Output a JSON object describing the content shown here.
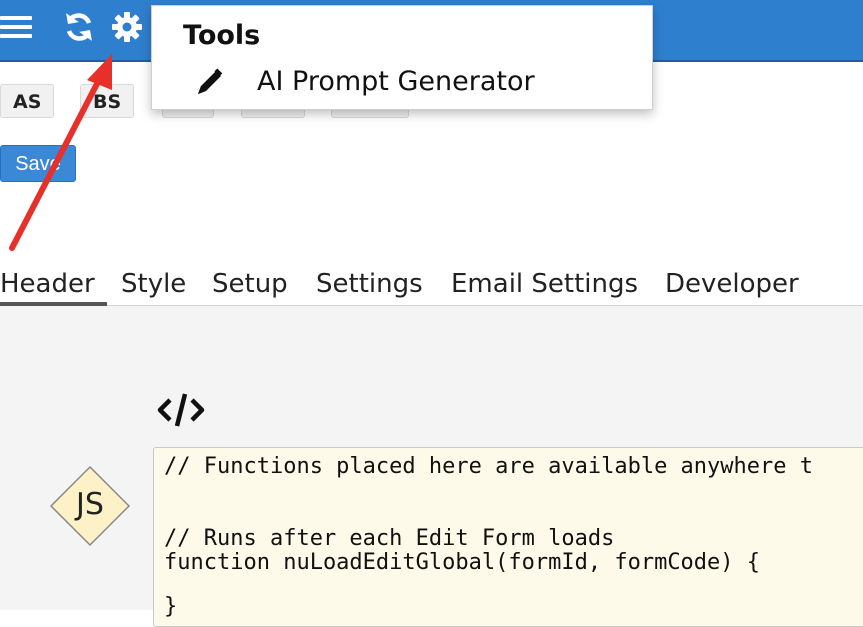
{
  "topbar": {
    "menu_icon": "hamburger-menu-icon",
    "refresh_icon": "refresh-icon",
    "settings_icon": "gear-icon",
    "bg_color": "#2f7fcf"
  },
  "toolbar": {
    "as_label": "AS",
    "bs_label": "BS",
    "save_label": "Save"
  },
  "tools_menu": {
    "title": "Tools",
    "items": [
      {
        "label": "AI Prompt Generator",
        "icon": "pencil-icon"
      }
    ]
  },
  "tabs": [
    {
      "label": "Header",
      "active": true
    },
    {
      "label": "Style"
    },
    {
      "label": "Setup"
    },
    {
      "label": "Settings"
    },
    {
      "label": "Email Settings"
    },
    {
      "label": "Developer"
    }
  ],
  "editor": {
    "code_icon": "code-tag-icon",
    "js_badge": "JS",
    "lines": [
      "// Functions placed here are available anywhere t",
      "",
      "// Runs after each Edit Form loads",
      "function nuLoadEditGlobal(formId, formCode) {",
      "",
      "}"
    ]
  },
  "annotation": {
    "arrow_color": "#e8302a"
  }
}
